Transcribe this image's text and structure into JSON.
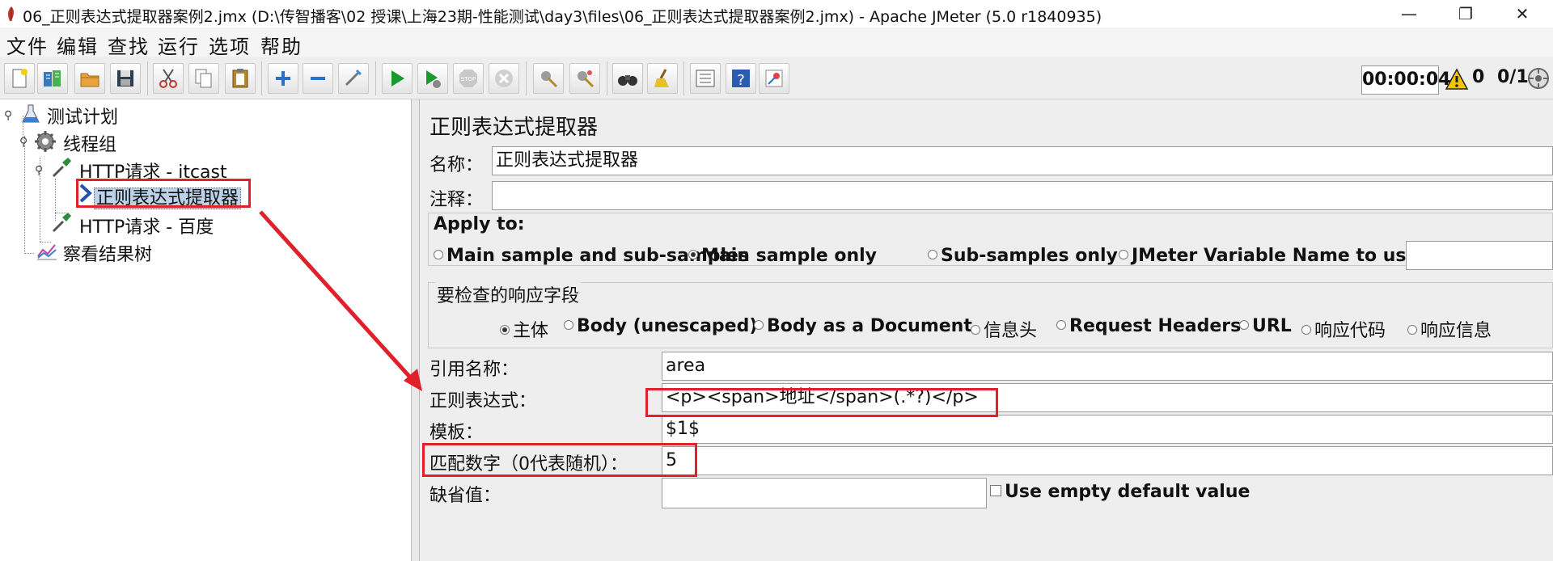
{
  "window": {
    "title": "06_正则表达式提取器案例2.jmx (D:\\传智播客\\02 授课\\上海23期-性能测试\\day3\\files\\06_正则表达式提取器案例2.jmx) - Apache JMeter (5.0 r1840935)",
    "minimize": "—",
    "restore": "❐",
    "close": "✕"
  },
  "menu": [
    "文件",
    "编辑",
    "查找",
    "运行",
    "选项",
    "帮助"
  ],
  "toolbar": {
    "timer": "00:00:04",
    "error_count": "0",
    "threads": "0/1"
  },
  "tree": {
    "test_plan": "测试计划",
    "thread_group": "线程组",
    "http_itcast": "HTTP请求 - itcast",
    "regex_extractor": "正则表达式提取器",
    "http_baidu": "HTTP请求 - 百度",
    "result_tree": "察看结果树"
  },
  "editor": {
    "heading": "正则表达式提取器",
    "name_label": "名称：",
    "name_value": "正则表达式提取器",
    "comment_label": "注释：",
    "comment_value": "",
    "apply_to": {
      "label": "Apply to:",
      "options": [
        "Main sample and sub-samples",
        "Main sample only",
        "Sub-samples only",
        "JMeter Variable Name to use"
      ],
      "selected": "Main sample only",
      "variable_value": ""
    },
    "response_field": {
      "label": "要检查的响应字段",
      "options": [
        "主体",
        "Body (unescaped)",
        "Body as a Document",
        "信息头",
        "Request Headers",
        "URL",
        "响应代码",
        "响应信息"
      ],
      "selected": "主体"
    },
    "ref_name_label": "引用名称：",
    "ref_name_value": "area",
    "regex_label": "正则表达式：",
    "regex_value": "<p><span>地址</span>(.*?)</p>",
    "template_label": "模板：",
    "template_value": "$1$",
    "match_no_label": "匹配数字（0代表随机）：",
    "match_no_value": "5",
    "default_label": "缺省值：",
    "default_value": "",
    "use_empty_default": "Use empty default value"
  },
  "annotation": {
    "color": "#e0202a"
  }
}
